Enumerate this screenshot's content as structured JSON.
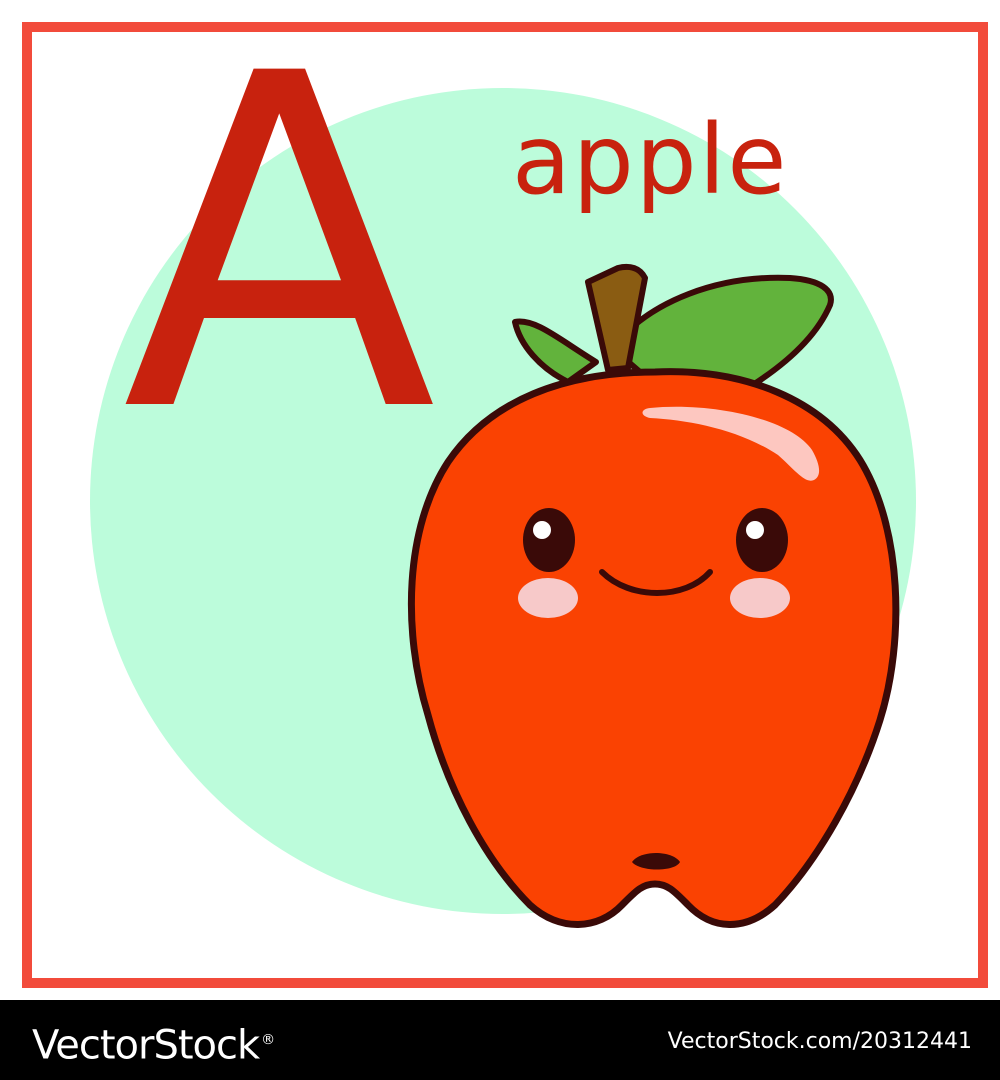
{
  "card": {
    "letter": "A",
    "word": "apple",
    "colors": {
      "frame": "#f24b3b",
      "circle": "#bcfcdb",
      "text": "#c8220e",
      "apple": "#fa4202",
      "leaf": "#62b33c",
      "stem": "#8a5c12",
      "outline": "#3a0a08",
      "blush": "#f7c9c9"
    },
    "illustration_icon": "kawaii-apple-icon"
  },
  "watermark": {
    "brand": "VectorStock",
    "registered_mark": "®",
    "stock_id": "VectorStock.com/20312441"
  }
}
